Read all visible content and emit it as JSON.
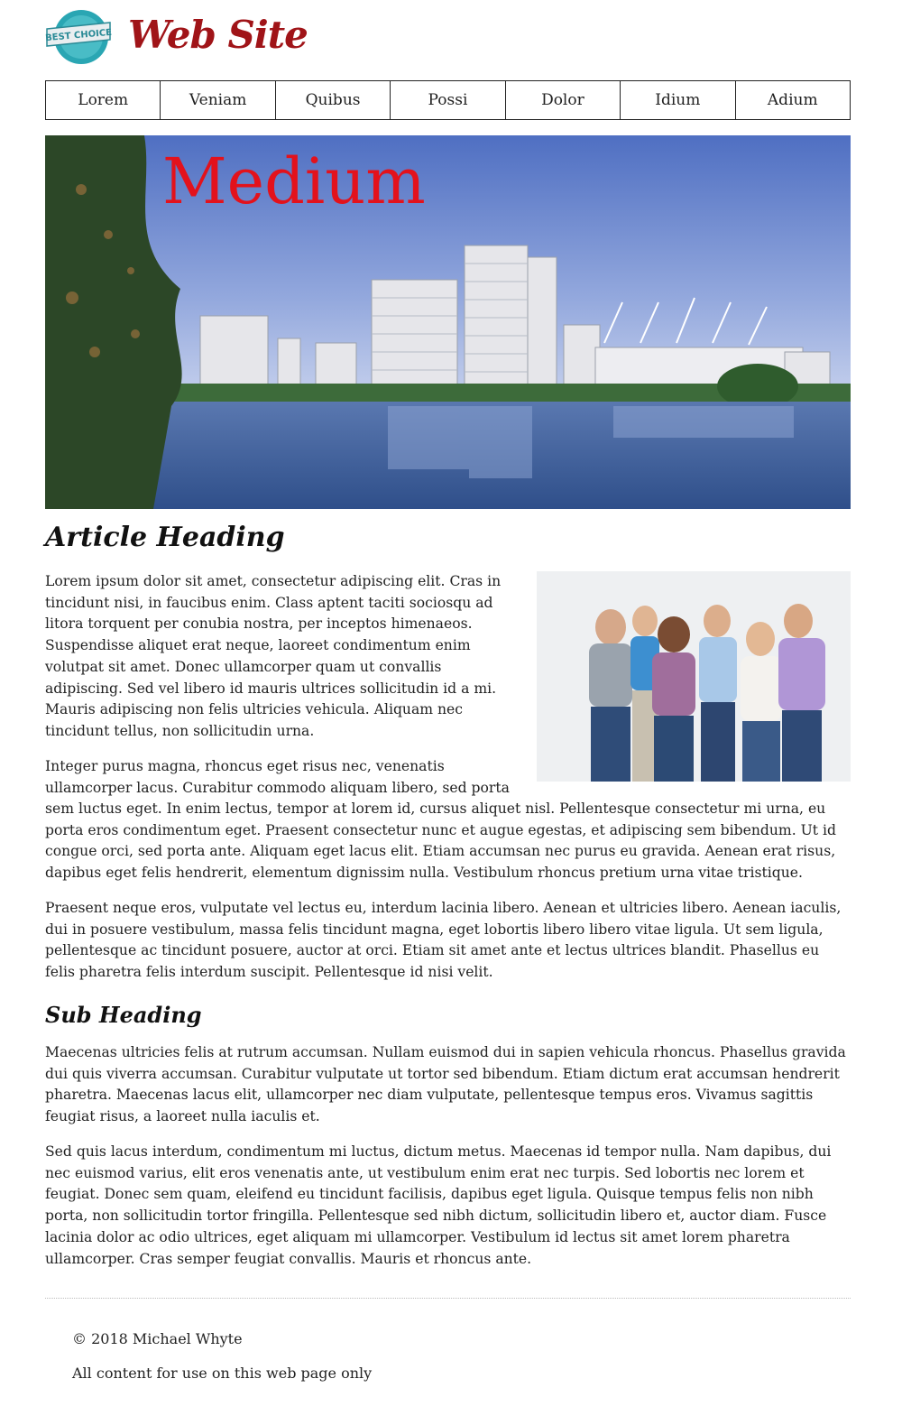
{
  "header": {
    "badge_text": "BEST CHOICE",
    "site_title": "Web Site"
  },
  "nav": {
    "items": [
      "Lorem",
      "Veniam",
      "Quibus",
      "Possi",
      "Dolor",
      "Idium",
      "Adium"
    ]
  },
  "hero": {
    "title": "Medium"
  },
  "article": {
    "heading": "Article Heading",
    "p1": "Lorem ipsum dolor sit amet, consectetur adipiscing elit. Cras in tincidunt nisi, in faucibus enim. Class aptent taciti sociosqu ad litora torquent per conubia nostra, per inceptos himenaeos. Suspendisse aliquet erat neque, laoreet condimentum enim volutpat sit amet. Donec ullamcorper quam ut convallis adipiscing. Sed vel libero id mauris ultrices sollicitudin id a mi. Mauris adipiscing non felis ultricies vehicula. Aliquam nec tincidunt tellus, non sollicitudin urna.",
    "p2_start": "Integer purus magna, rhoncus eget risus nec, venenatis ullamcorper lacus. Curabitur commodo aliquam libero, sed porta",
    "p2_rest": "sem luctus eget. In enim lectus, tempor at lorem id, cursus aliquet nisl. Pellentesque consectetur mi urna, eu porta eros condimentum eget. Praesent consectetur nunc et augue egestas, et adipiscing sem bibendum. Ut id congue orci, sed porta ante. Aliquam eget lacus elit. Etiam accumsan nec purus eu gravida. Aenean erat risus, dapibus eget felis hendrerit, elementum dignissim nulla. Vestibulum rhoncus pretium urna vitae tristique.",
    "p3": "Praesent neque eros, vulputate vel lectus eu, interdum lacinia libero. Aenean et ultricies libero. Aenean iaculis, dui in posuere vestibulum, massa felis tincidunt magna, eget lobortis libero libero vitae ligula. Ut sem ligula, pellentesque ac tincidunt posuere, auctor at orci. Etiam sit amet ante et lectus ultrices blandit. Phasellus eu felis pharetra felis interdum suscipit. Pellentesque id nisi velit.",
    "sub_heading": "Sub Heading",
    "p4": "Maecenas ultricies felis at rutrum accumsan. Nullam euismod dui in sapien vehicula rhoncus. Phasellus gravida dui quis viverra accumsan. Curabitur vulputate ut tortor sed bibendum. Etiam dictum erat accumsan hendrerit pharetra. Maecenas lacus elit, ullamcorper nec diam vulputate, pellentesque tempus eros. Vivamus sagittis feugiat risus, a laoreet nulla iaculis et.",
    "p5": "Sed quis lacus interdum, condimentum mi luctus, dictum metus. Maecenas id tempor nulla. Nam dapibus, dui nec euismod varius, elit eros venenatis ante, ut vestibulum enim erat nec turpis. Sed lobortis nec lorem et feugiat. Donec sem quam, eleifend eu tincidunt facilisis, dapibus eget ligula. Quisque tempus felis non nibh porta, non sollicitudin tortor fringilla. Pellentesque sed nibh dictum, sollicitudin libero et, auctor diam. Fusce lacinia dolor ac odio ultrices, eget aliquam mi ullamcorper. Vestibulum id lectus sit amet lorem pharetra ullamcorper. Cras semper feugiat convallis. Mauris et rhoncus ante."
  },
  "footer": {
    "copyright": "© 2018 Michael Whyte",
    "note": "All content for use on this web page only"
  },
  "colors": {
    "brand_red": "#a01418",
    "hero_title": "#e3121c",
    "badge_teal": "#2aa6b3"
  }
}
